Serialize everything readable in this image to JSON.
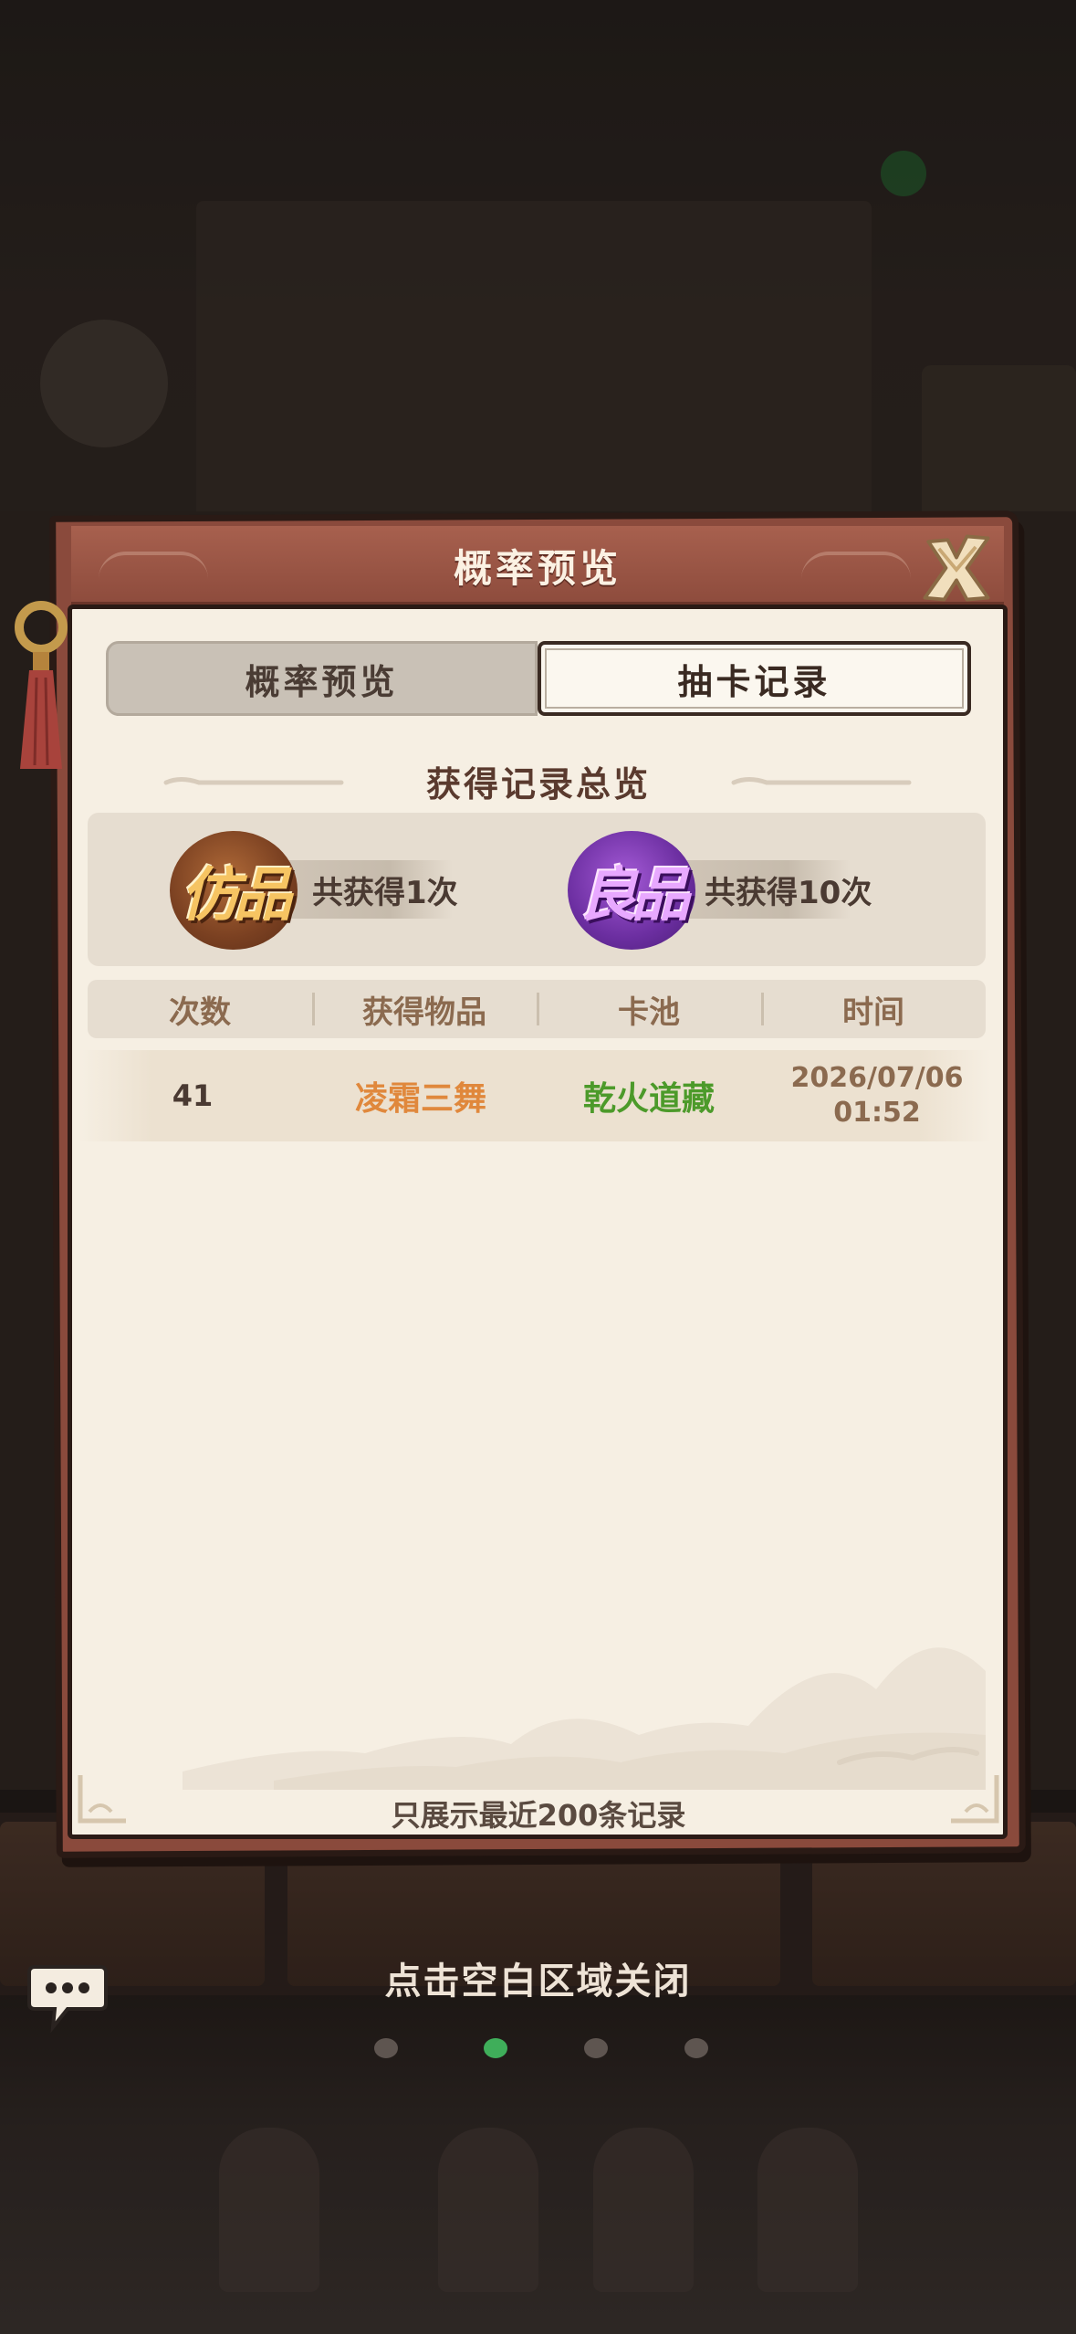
{
  "dialog": {
    "title": "概率预览"
  },
  "tabs": [
    {
      "label": "概率预览",
      "active": false
    },
    {
      "label": "抽卡记录",
      "active": true
    }
  ],
  "summary": {
    "heading": "获得记录总览",
    "items": [
      {
        "badge": "仿品",
        "label": "共获得1次",
        "color": "#b06a38"
      },
      {
        "badge": "良品",
        "label": "共获得10次",
        "color": "#8a3fc0"
      }
    ]
  },
  "table": {
    "headers": [
      "次数",
      "获得物品",
      "卡池",
      "时间"
    ],
    "rows": [
      {
        "count": "41",
        "item": "凌霜三舞",
        "pool": "乾火道藏",
        "date": "2026/07/06",
        "time": "01:52"
      }
    ],
    "colors": {
      "item": "#e0883c",
      "pool": "#4c9a2a"
    }
  },
  "footer_note": "只展示最近200条记录",
  "close_hint": "点击空白区域关闭",
  "icons": {
    "close": "close-icon",
    "chat": "chat-bubble-icon"
  }
}
